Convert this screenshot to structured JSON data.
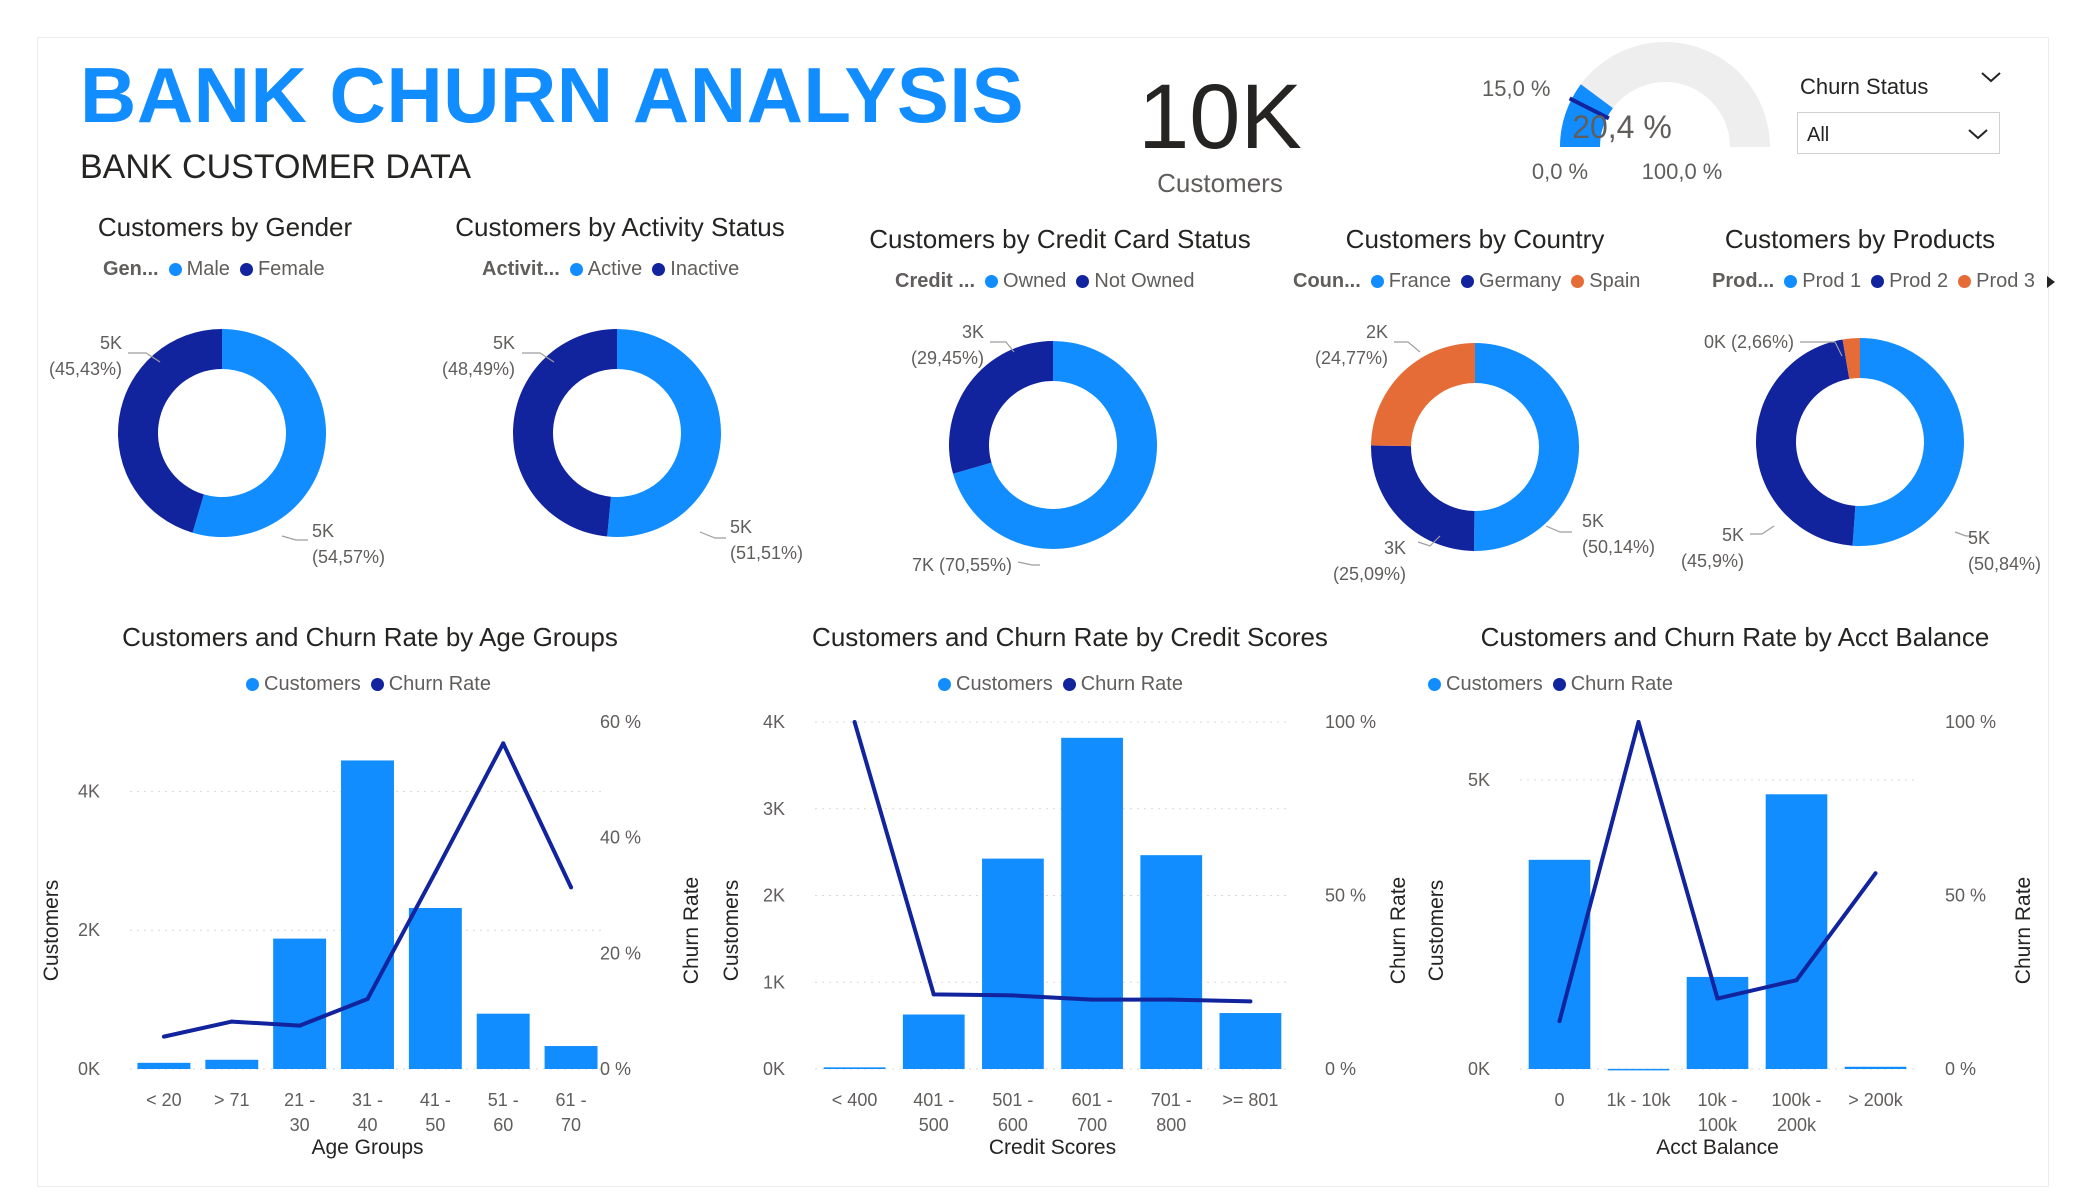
{
  "header": {
    "title": "BANK CHURN ANALYSIS",
    "subtitle": "BANK CUSTOMER DATA"
  },
  "kpi": {
    "value": "10K",
    "label": "Customers"
  },
  "gauge": {
    "value_label": "20,4 %",
    "min_label": "0,0 %",
    "max_label": "100,0 %",
    "target_label": "15,0 %",
    "value": 20.4,
    "target": 15.0,
    "min": 0,
    "max": 100
  },
  "slicer": {
    "title": "Churn Status",
    "selected": "All"
  },
  "colors": {
    "blue": "#118dff",
    "navy": "#12239e",
    "orange": "#e66c37",
    "track": "#eeeeee"
  },
  "donuts": {
    "gender": {
      "title": "Customers by Gender",
      "legend_title": "Gen...",
      "legend": [
        "Male",
        "Female"
      ],
      "label_a_1": "5K",
      "label_a_2": "(45,43%)",
      "label_b_1": "5K",
      "label_b_2": "(54,57%)"
    },
    "activity": {
      "title": "Customers by Activity Status",
      "legend_title": "Activit...",
      "legend": [
        "Active",
        "Inactive"
      ],
      "label_a_1": "5K",
      "label_a_2": "(48,49%)",
      "label_b_1": "5K",
      "label_b_2": "(51,51%)"
    },
    "credit_card": {
      "title": "Customers by Credit Card Status",
      "legend_title": "Credit ...",
      "legend": [
        "Owned",
        "Not Owned"
      ],
      "label_a_1": "3K",
      "label_a_2": "(29,45%)",
      "label_b_1": "7K (70,55%)"
    },
    "country": {
      "title": "Customers by Country",
      "legend_title": "Coun...",
      "legend": [
        "France",
        "Germany",
        "Spain"
      ],
      "label_a_1": "2K",
      "label_a_2": "(24,77%)",
      "label_b_1": "5K",
      "label_b_2": "(50,14%)",
      "label_c_1": "3K",
      "label_c_2": "(25,09%)"
    },
    "products": {
      "title": "Customers by Products",
      "legend_title": "Prod...",
      "legend": [
        "Prod 1",
        "Prod 2",
        "Prod 3"
      ],
      "label_a_1": "0K (2,66%)",
      "label_b_1": "5K",
      "label_b_2": "(50,84%)",
      "label_c_1": "5K",
      "label_c_2": "(45,9%)"
    }
  },
  "combo_charts": {
    "legend": [
      "Customers",
      "Churn Rate"
    ],
    "age": {
      "title": "Customers and Churn Rate by Age Groups",
      "xlabel": "Age Groups",
      "ylabel": "Customers",
      "y2label": "Churn Rate",
      "yticks": [
        "0K",
        "2K",
        "4K"
      ],
      "y2ticks": [
        "0 %",
        "20 %",
        "40 %",
        "60 %"
      ],
      "xticks": [
        [
          "< 20"
        ],
        [
          "> 71"
        ],
        [
          "21 -",
          "30"
        ],
        [
          "31 -",
          "40"
        ],
        [
          "41 -",
          "50"
        ],
        [
          "51 -",
          "60"
        ],
        [
          "61 -",
          "70"
        ]
      ]
    },
    "credit": {
      "title": "Customers and Churn Rate by Credit Scores",
      "xlabel": "Credit Scores",
      "ylabel": "Customers",
      "y2label": "Churn Rate",
      "yticks": [
        "0K",
        "1K",
        "2K",
        "3K",
        "4K"
      ],
      "y2ticks": [
        "0 %",
        "50 %",
        "100 %"
      ],
      "xticks": [
        [
          "< 400"
        ],
        [
          "401 -",
          "500"
        ],
        [
          "501 -",
          "600"
        ],
        [
          "601 -",
          "700"
        ],
        [
          "701 -",
          "800"
        ],
        [
          ">= 801"
        ]
      ]
    },
    "balance": {
      "title": "Customers and Churn Rate by Acct Balance",
      "xlabel": "Acct Balance",
      "ylabel": "Customers",
      "y2label": "Churn Rate",
      "yticks": [
        "0K",
        "5K"
      ],
      "y2ticks": [
        "0 %",
        "50 %",
        "100 %"
      ],
      "xticks": [
        [
          "0"
        ],
        [
          "1k - 10k"
        ],
        [
          "10k -",
          "100k"
        ],
        [
          "100k -",
          "200k"
        ],
        [
          "> 200k"
        ]
      ]
    }
  },
  "chart_data": [
    {
      "type": "pie",
      "title": "Customers by Gender",
      "categories": [
        "Male",
        "Female"
      ],
      "values": [
        54.57,
        45.43
      ]
    },
    {
      "type": "pie",
      "title": "Customers by Activity Status",
      "categories": [
        "Active",
        "Inactive"
      ],
      "values": [
        51.51,
        48.49
      ]
    },
    {
      "type": "pie",
      "title": "Customers by Credit Card Status",
      "categories": [
        "Owned",
        "Not Owned"
      ],
      "values": [
        70.55,
        29.45
      ]
    },
    {
      "type": "pie",
      "title": "Customers by Country",
      "categories": [
        "France",
        "Germany",
        "Spain"
      ],
      "values": [
        50.14,
        25.09,
        24.77
      ]
    },
    {
      "type": "pie",
      "title": "Customers by Products",
      "categories": [
        "Prod 1",
        "Prod 2",
        "Prod 3"
      ],
      "values": [
        50.84,
        45.9,
        2.66
      ]
    },
    {
      "type": "bar",
      "title": "Customers and Churn Rate by Age Groups",
      "categories": [
        "< 20",
        "> 71",
        "21 - 30",
        "31 - 40",
        "41 - 50",
        "51 - 60",
        "61 - 70"
      ],
      "xlabel": "Age Groups",
      "ylabel": "Customers",
      "y2label": "Churn Rate",
      "ylim": [
        0,
        5000
      ],
      "y2lim": [
        0,
        60
      ],
      "series": [
        {
          "name": "Customers",
          "values": [
            89,
            133,
            1879,
            4446,
            2320,
            797,
            331
          ]
        },
        {
          "name": "Churn Rate",
          "values": [
            5.6,
            8.2,
            7.5,
            12.1,
            34.0,
            56.3,
            31.4
          ]
        }
      ]
    },
    {
      "type": "bar",
      "title": "Customers and Churn Rate by Credit Scores",
      "categories": [
        "< 400",
        "401 - 500",
        "501 - 600",
        "601 - 700",
        "701 - 800",
        ">= 801"
      ],
      "xlabel": "Credit Scores",
      "ylabel": "Customers",
      "y2label": "Churn Rate",
      "ylim": [
        0,
        4000
      ],
      "y2lim": [
        0,
        100
      ],
      "series": [
        {
          "name": "Customers",
          "values": [
            19,
            628,
            2425,
            3818,
            2465,
            645
          ]
        },
        {
          "name": "Churn Rate",
          "values": [
            100,
            21.5,
            21.2,
            20.0,
            20.0,
            19.5
          ]
        }
      ]
    },
    {
      "type": "bar",
      "title": "Customers and Churn Rate by Acct Balance",
      "categories": [
        "0",
        "1k - 10k",
        "10k - 100k",
        "100k - 200k",
        "> 200k"
      ],
      "xlabel": "Acct Balance",
      "ylabel": "Customers",
      "y2label": "Churn Rate",
      "ylim": [
        0,
        6000
      ],
      "y2lim": [
        0,
        100
      ],
      "series": [
        {
          "name": "Customers",
          "values": [
            3617,
            2,
            1592,
            4750,
            39
          ]
        },
        {
          "name": "Churn Rate",
          "values": [
            13.8,
            100,
            20.3,
            25.6,
            56.4
          ]
        }
      ]
    }
  ]
}
